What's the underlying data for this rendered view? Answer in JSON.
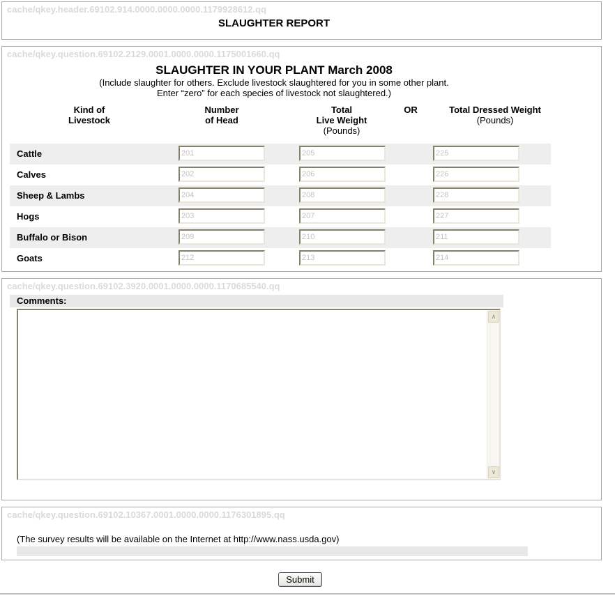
{
  "header": {
    "watermark": "cache/qkey.header.69102.914.0000.0000.0000.1179928612.qq",
    "title": "SLAUGHTER REPORT"
  },
  "plant": {
    "watermark": "cache/qkey.question.69102.2129.0001.0000.0000.1175001660.qq",
    "title": "SLAUGHTER IN YOUR PLANT March 2008",
    "instr1": "(Include slaughter for others. Exclude livestock slaughtered for you in some other plant.",
    "instr2": "Enter “zero” for each species of livestock not slaughtered.)",
    "columns": {
      "kind1": "Kind of",
      "kind2": "Livestock",
      "head1": "Number",
      "head2": "of Head",
      "live1": "Total",
      "live2": "Live Weight",
      "live3": "(Pounds)",
      "or": "OR",
      "dressed1": "Total Dressed Weight",
      "dressed2": "(Pounds)"
    },
    "rows": [
      {
        "label": "Cattle",
        "head_code": "201",
        "live_code": "205",
        "dressed_code": "225"
      },
      {
        "label": "Calves",
        "head_code": "202",
        "live_code": "206",
        "dressed_code": "226"
      },
      {
        "label": "Sheep & Lambs",
        "head_code": "204",
        "live_code": "208",
        "dressed_code": "228"
      },
      {
        "label": "Hogs",
        "head_code": "203",
        "live_code": "207",
        "dressed_code": "227"
      },
      {
        "label": "Buffalo or Bison",
        "head_code": "209",
        "live_code": "210",
        "dressed_code": "211"
      },
      {
        "label": "Goats",
        "head_code": "212",
        "live_code": "213",
        "dressed_code": "214"
      }
    ]
  },
  "comments": {
    "watermark": "cache/qkey.question.69102.3920.0001.0000.0000.1170685540.qq",
    "label": "Comments:",
    "value": "",
    "icons": {
      "chevron_up": "∧",
      "chevron_down": "∨"
    }
  },
  "results": {
    "watermark": "cache/qkey.question.69102.10367.0001.0000.0000.1176301895.qq",
    "note": "(The survey results will be available on the Internet at http://www.nass.usda.gov)"
  },
  "submit_label": "Submit",
  "colors": {
    "panel_border": "#a8a8a8",
    "watermark_text": "#dadada",
    "row_shade": "#eeeeee",
    "bar_fill": "#e8e8e8",
    "input_code_text": "#c4c4c4",
    "input_border_dark": "#84806a",
    "scroll_button_face": "#ece9d8"
  }
}
